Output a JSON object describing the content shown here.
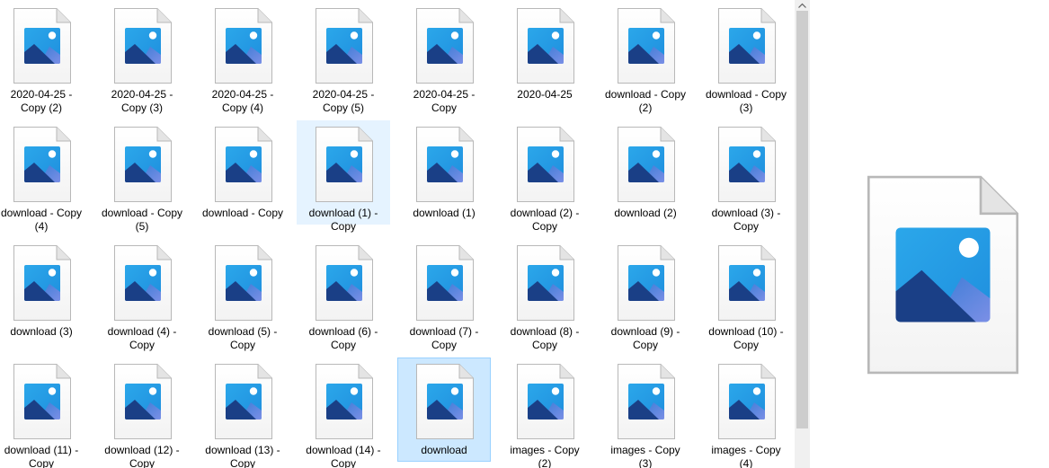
{
  "files": [
    {
      "label": "2020-04-25 -\nCopy (2)",
      "state": "normal"
    },
    {
      "label": "2020-04-25 -\nCopy (3)",
      "state": "normal"
    },
    {
      "label": "2020-04-25 -\nCopy (4)",
      "state": "normal"
    },
    {
      "label": "2020-04-25 -\nCopy (5)",
      "state": "normal"
    },
    {
      "label": "2020-04-25 -\nCopy",
      "state": "normal"
    },
    {
      "label": "2020-04-25",
      "state": "normal"
    },
    {
      "label": "download - Copy\n(2)",
      "state": "normal"
    },
    {
      "label": "download - Copy\n(3)",
      "state": "normal"
    },
    {
      "label": "download - Copy\n(4)",
      "state": "normal"
    },
    {
      "label": "download - Copy\n(5)",
      "state": "normal"
    },
    {
      "label": "download - Copy",
      "state": "normal"
    },
    {
      "label": "download (1) -\nCopy",
      "state": "hover"
    },
    {
      "label": "download (1)",
      "state": "normal"
    },
    {
      "label": "download (2) -\nCopy",
      "state": "normal"
    },
    {
      "label": "download (2)",
      "state": "normal"
    },
    {
      "label": "download (3) -\nCopy",
      "state": "normal"
    },
    {
      "label": "download (3)",
      "state": "normal"
    },
    {
      "label": "download (4) -\nCopy",
      "state": "normal"
    },
    {
      "label": "download (5) -\nCopy",
      "state": "normal"
    },
    {
      "label": "download (6) -\nCopy",
      "state": "normal"
    },
    {
      "label": "download (7) -\nCopy",
      "state": "normal"
    },
    {
      "label": "download (8) -\nCopy",
      "state": "normal"
    },
    {
      "label": "download (9) -\nCopy",
      "state": "normal"
    },
    {
      "label": "download (10) -\nCopy",
      "state": "normal"
    },
    {
      "label": "download (11) -\nCopy",
      "state": "normal"
    },
    {
      "label": "download (12) -\nCopy",
      "state": "normal"
    },
    {
      "label": "download (13) -\nCopy",
      "state": "normal"
    },
    {
      "label": "download (14) -\nCopy",
      "state": "normal"
    },
    {
      "label": "download",
      "state": "selected"
    },
    {
      "label": "images - Copy\n(2)",
      "state": "normal"
    },
    {
      "label": "images - Copy\n(3)",
      "state": "normal"
    },
    {
      "label": "images - Copy\n(4)",
      "state": "normal"
    }
  ],
  "file_icon": "image-file-icon",
  "preview_icon": "image-file-icon",
  "colors": {
    "hover_bg": "#e5f3ff",
    "selected_bg": "#cce8ff",
    "selected_border": "#99d1ff",
    "scrollbar_thumb": "#cdcdcd",
    "scrollbar_track": "#f0f0f0"
  }
}
